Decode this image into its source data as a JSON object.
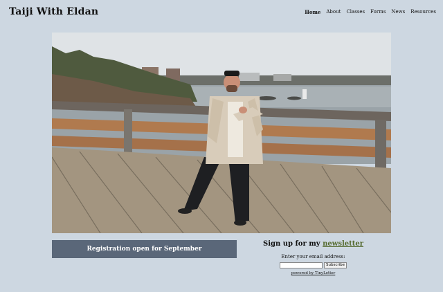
{
  "site": {
    "title": "Taiji With Eldan"
  },
  "nav": {
    "items": [
      {
        "label": "Home"
      },
      {
        "label": "About"
      },
      {
        "label": "Classes"
      },
      {
        "label": "Forms"
      },
      {
        "label": "News"
      },
      {
        "label": "Resources"
      }
    ]
  },
  "banner": {
    "text": "Registration open for September"
  },
  "signup": {
    "heading_prefix": "Sign up for my",
    "heading_link": "newsletter",
    "email_label": "Enter your email address:",
    "email_value": "",
    "submit_label": "Subscribe",
    "powered_by": "powered by TinyLetter"
  },
  "colors": {
    "page_background": "#cdd7e1",
    "banner_background": "#5a6779",
    "link_accent": "#556b2f"
  }
}
